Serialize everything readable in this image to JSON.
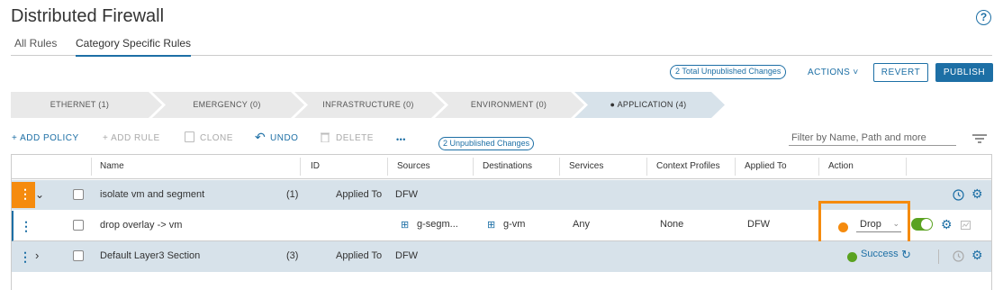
{
  "header": {
    "title": "Distributed Firewall",
    "help_icon": "?"
  },
  "tabs": [
    {
      "label": "All Rules"
    },
    {
      "label": "Category Specific Rules"
    }
  ],
  "top_actions": {
    "unpublished_badge": "2 Total Unpublished Changes",
    "actions_label": "ACTIONS ˅",
    "revert_label": "REVERT",
    "publish_label": "PUBLISH"
  },
  "categories": [
    {
      "label": "ETHERNET (1)"
    },
    {
      "label": "EMERGENCY (0)"
    },
    {
      "label": "INFRASTRUCTURE (0)"
    },
    {
      "label": "ENVIRONMENT (0)"
    },
    {
      "label": "● APPLICATION (4)"
    }
  ],
  "toolbar": {
    "add_policy": "+ ADD POLICY",
    "add_rule": "+ ADD RULE",
    "clone": "CLONE",
    "undo": "UNDO",
    "delete": "DELETE",
    "more": "•••",
    "unpublished_badge": "2 Unpublished Changes",
    "filter_placeholder": "Filter by Name, Path and more"
  },
  "columns": [
    "Name",
    "ID",
    "Sources",
    "Destinations",
    "Services",
    "Context Profiles",
    "Applied To",
    "Action"
  ],
  "rows": [
    {
      "name": "isolate vm and segment",
      "count": "(1)",
      "applied_prefix": "Applied To",
      "applied": "DFW"
    },
    {
      "name": "drop overlay -> vm",
      "source": "g-segm...",
      "destination": "g-vm",
      "service": "Any",
      "context": "None",
      "applied": "DFW",
      "action": "Drop"
    },
    {
      "name": "Default Layer3 Section",
      "count": "(3)",
      "applied_prefix": "Applied To",
      "applied": "DFW",
      "status": "Success"
    }
  ],
  "colors": {
    "accent": "#1d6fa5",
    "highlight": "#f58b0e",
    "success": "#5aa220",
    "row_bg": "#d7e2ea"
  }
}
